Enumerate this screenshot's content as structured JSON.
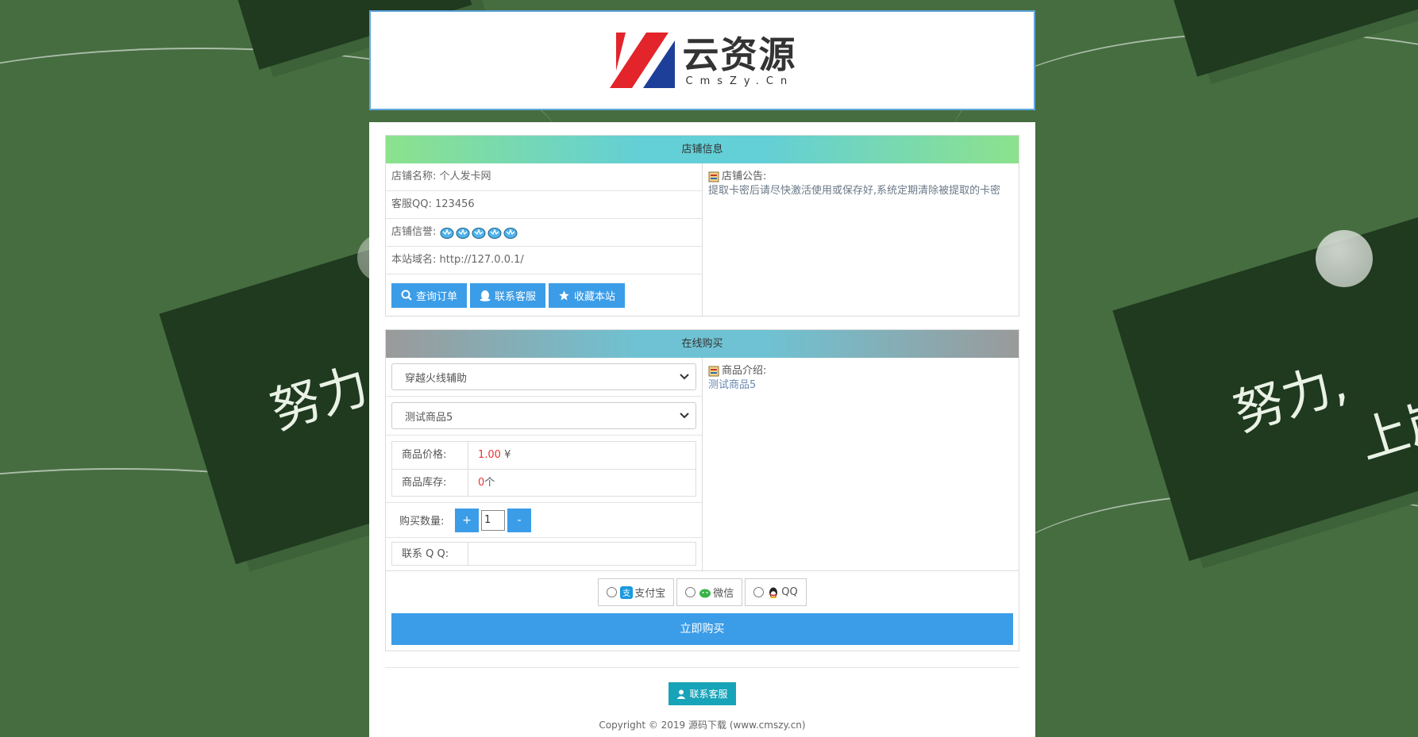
{
  "logo": {
    "cn_text": "云资源",
    "en_text": "CmsZy.Cn"
  },
  "background": {
    "board_left_text": "努力",
    "board_right_text_1": "努力,",
    "board_right_text_2": "上岸"
  },
  "shop": {
    "header": "店铺信息",
    "name_label": "店铺名称:",
    "name_value": "个人发卡网",
    "qq_label": "客服QQ:",
    "qq_value": "123456",
    "reputation_label": "店铺信誉:",
    "domain_label": "本站域名:",
    "domain_value": "http://127.0.0.1/",
    "buttons": {
      "query_order": "查询订单",
      "contact_service": "联系客服",
      "bookmark": "收藏本站"
    },
    "announcement_title": "店铺公告:",
    "announcement_text": "提取卡密后请尽快激活使用或保存好,系统定期清除被提取的卡密"
  },
  "buy": {
    "header": "在线购买",
    "category_selected": "穿越火线辅助",
    "product_selected": "测试商品5",
    "price_label": "商品价格:",
    "price_value": "1.00",
    "price_unit": "¥",
    "stock_label": "商品库存:",
    "stock_value": "0",
    "stock_unit": "个",
    "qty_label": "购买数量:",
    "qty_plus": "+",
    "qty_value": "1",
    "qty_minus": "-",
    "contact_qq_label": "联系 Q Q:",
    "contact_qq_value": "",
    "intro_title": "商品介绍:",
    "intro_text": "测试商品5",
    "payments": [
      "支付宝",
      "微信",
      "QQ"
    ],
    "buy_button": "立即购买"
  },
  "footer": {
    "contact_button": "联系客服",
    "copyright": "Copyright © 2019 源码下载 (www.cmszy.cn)"
  },
  "colors": {
    "accent": "#3b9de8",
    "price": "#e33333",
    "footer_button": "#17a3b8",
    "background": "#466d40"
  }
}
